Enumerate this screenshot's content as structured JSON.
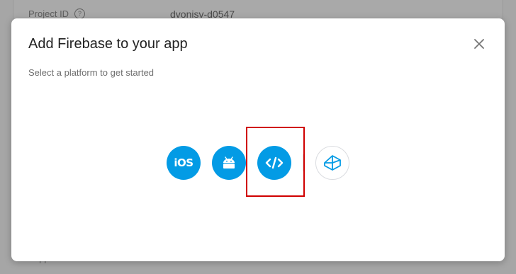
{
  "background": {
    "project_id_label": "Project ID",
    "project_id_value": "dvonisv-d0547",
    "your_apps_label": "Your apps"
  },
  "dialog": {
    "title": "Add Firebase to your app",
    "subtitle": "Select a platform to get started",
    "close_icon": "close-icon"
  },
  "platforms": [
    {
      "name": "ios",
      "label": "iOS",
      "icon": "ios-icon",
      "color": "#039be5"
    },
    {
      "name": "android",
      "label": "",
      "icon": "android-icon",
      "color": "#039be5"
    },
    {
      "name": "web",
      "label": "",
      "icon": "code-icon",
      "color": "#039be5"
    },
    {
      "name": "unity",
      "label": "",
      "icon": "unity-icon",
      "color": "#ffffff"
    }
  ],
  "colors": {
    "accent": "#039be5",
    "highlight": "#d00000"
  }
}
